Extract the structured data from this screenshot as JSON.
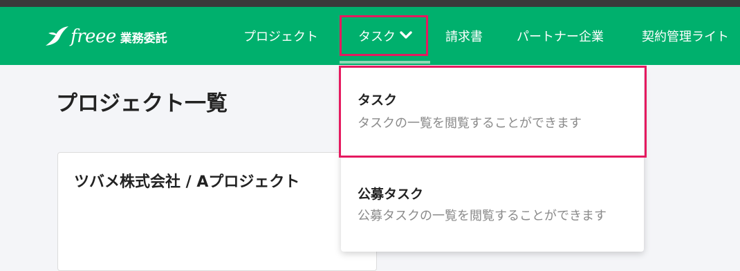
{
  "header": {
    "logo_text": "freee",
    "logo_subtitle": "業務委託",
    "brand_color": "#00b06d",
    "nav": [
      {
        "label": "プロジェクト"
      },
      {
        "label": "タスク",
        "icon": "chevron-down-icon",
        "active": true
      },
      {
        "label": "請求書"
      },
      {
        "label": "パートナー企業"
      },
      {
        "label": "契約管理ライト"
      }
    ]
  },
  "page": {
    "title": "プロジェクト一覧"
  },
  "card": {
    "title": "ツバメ株式会社 / Aプロジェクト"
  },
  "dropdown": {
    "items": [
      {
        "label": "タスク",
        "description": "タスクの一覧を閲覧することができます",
        "highlighted": true
      },
      {
        "label": "公募タスク",
        "description": "公募タスクの一覧を閲覧することができます",
        "highlighted": false
      }
    ]
  },
  "highlight_color": "#e5195f"
}
